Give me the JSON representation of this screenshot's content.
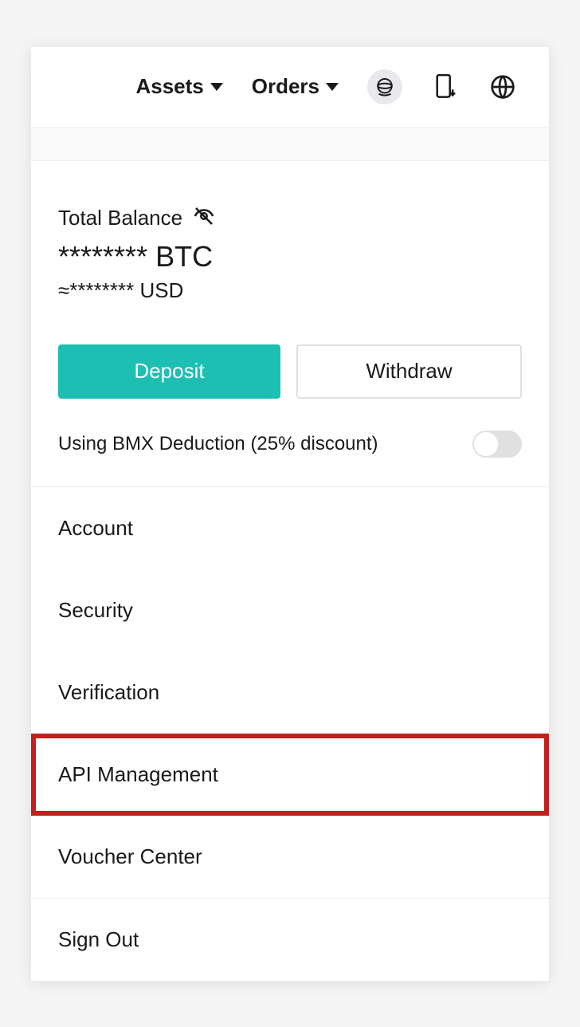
{
  "topbar": {
    "assets_label": "Assets",
    "orders_label": "Orders"
  },
  "balance": {
    "label": "Total Balance",
    "primary_value": "********",
    "primary_unit": "BTC",
    "approx_symbol": "≈",
    "secondary_value": "********",
    "secondary_unit": "USD"
  },
  "actions": {
    "deposit_label": "Deposit",
    "withdraw_label": "Withdraw"
  },
  "deduction": {
    "label": "Using BMX Deduction (25% discount)",
    "enabled": false
  },
  "menu": {
    "account": "Account",
    "security": "Security",
    "verification": "Verification",
    "api_management": "API Management",
    "voucher_center": "Voucher Center",
    "sign_out": "Sign Out"
  }
}
